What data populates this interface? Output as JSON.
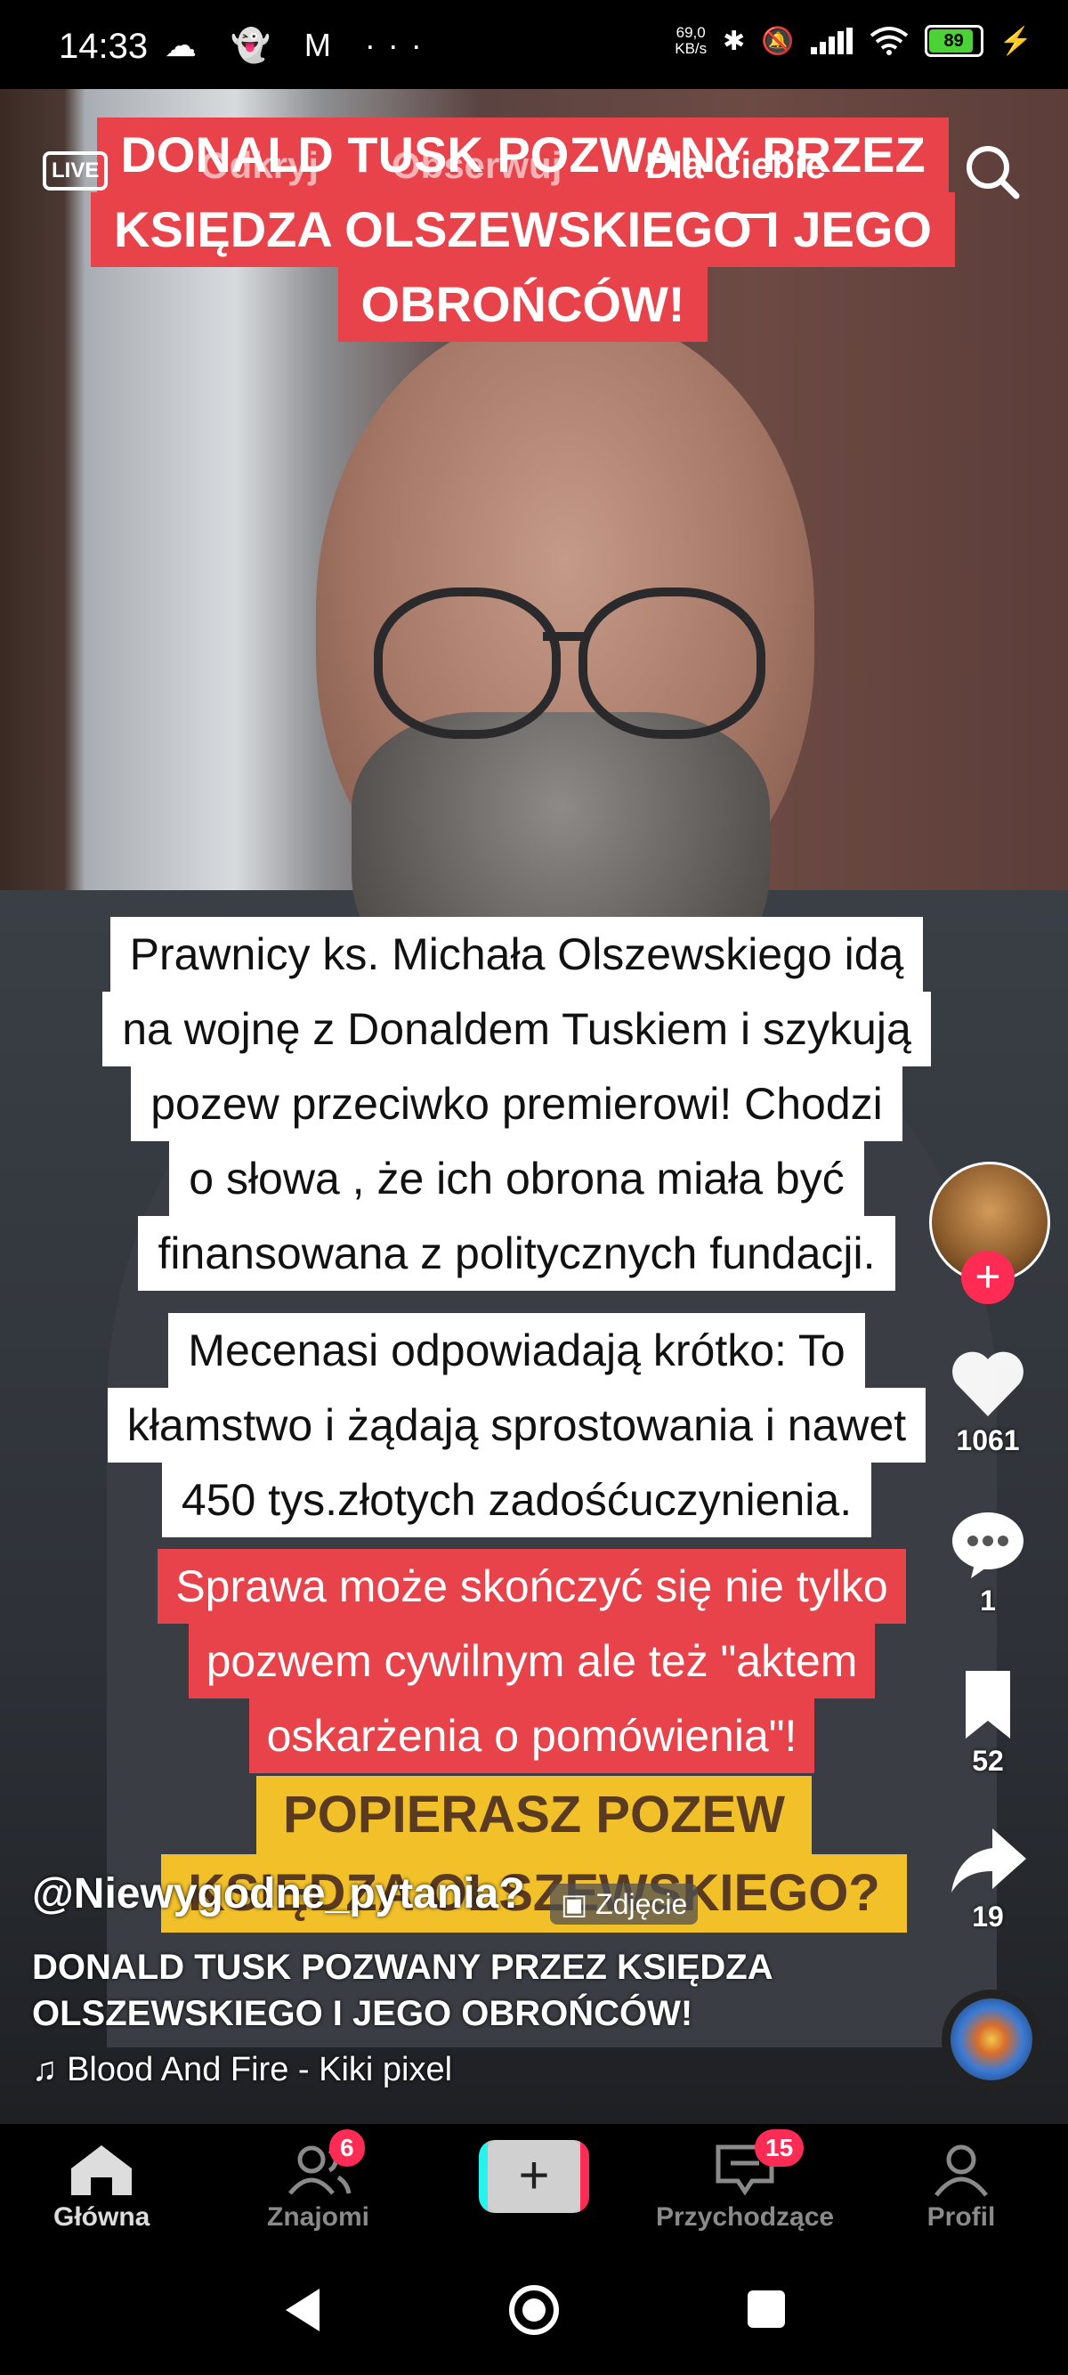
{
  "status": {
    "time": "14:33",
    "left_icons": "☁ 👻 M ···",
    "speed": "69,0\nKB/s",
    "battery": "89",
    "battery_level": 0.89
  },
  "top_nav": {
    "live": "LIVE",
    "tabs": [
      "Odkryj",
      "Obserwuj",
      "Dla Ciebie"
    ],
    "active_tab": "Dla Ciebie"
  },
  "video": {
    "banner_lines": [
      "DONALD TUSK POZWANY PRZEZ",
      "KSIĘDZA OLSZEWSKIEGO I JEGO",
      "OBROŃCÓW!"
    ],
    "white_block1": [
      "Prawnicy ks. Michała Olszewskiego idą",
      "na wojnę z Donaldem Tuskiem i szykują",
      "pozew przeciwko premierowi! Chodzi",
      "o słowa , że ich obrona miała być",
      "finansowana z politycznych fundacji."
    ],
    "white_block2": [
      "Mecenasi odpowiadają krótko: To",
      "kłamstwo i żądają sprostowania i nawet",
      "450 tys.złotych zadośćuczynienia."
    ],
    "red_block": [
      "Sprawa może skończyć się nie tylko",
      "pozwem cywilnym ale też \"aktem",
      "oskarżenia o pomówienia\"!"
    ],
    "yellow_block": [
      "POPIERASZ POZEW",
      "KSIĘDZA OLSZEWSKIEGO?"
    ]
  },
  "rail": {
    "likes": "1061",
    "comments": "1",
    "saves": "52",
    "shares": "19"
  },
  "caption": {
    "username": "@Niewygodne_pytania?",
    "badge": "Zdjęcie",
    "title_line1": "DONALD TUSK POZWANY PRZEZ KSIĘDZA",
    "title_line2": "OLSZEWSKIEGO I JEGO OBROŃCÓW!",
    "music": "Blood And Fire - Kiki pixel"
  },
  "bottom_nav": {
    "home": "Główna",
    "friends": "Znajomi",
    "friends_badge": "6",
    "inbox": "Przychodzące",
    "inbox_badge": "15",
    "profile": "Profil",
    "create": "+"
  }
}
